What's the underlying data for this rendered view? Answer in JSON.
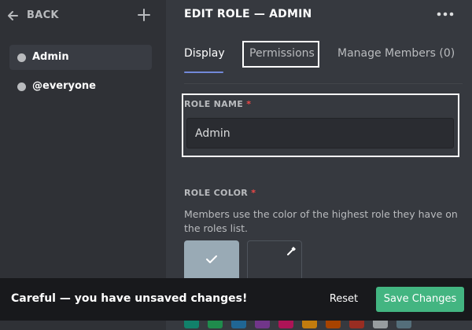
{
  "sidebar": {
    "back_label": "BACK",
    "roles": [
      {
        "label": "Admin",
        "active": true
      },
      {
        "label": "@everyone",
        "active": false
      }
    ]
  },
  "header": {
    "title": "EDIT ROLE — ADMIN"
  },
  "tabs": [
    {
      "label": "Display",
      "active": true
    },
    {
      "label": "Permissions",
      "active": false,
      "highlighted": true
    },
    {
      "label": "Manage Members (0)",
      "active": false
    }
  ],
  "role_name": {
    "label": "ROLE NAME",
    "required_mark": "*",
    "value": "Admin"
  },
  "role_color": {
    "label": "ROLE COLOR",
    "required_mark": "*",
    "description": "Members use the color of the highest role they have on the roles list.",
    "default_color": "#99aab5",
    "palette_row1": [
      "#1abc9c",
      "#2ecc71",
      "#3498db",
      "#9b59b6",
      "#e91e63",
      "#f1c40f",
      "#e67e22",
      "#e74c3c",
      "#95a5a6",
      "#607d8b"
    ],
    "palette_row2": [
      "#11806a",
      "#1f8b4c",
      "#206694",
      "#71368a",
      "#ad1457",
      "#c27c0e",
      "#a84300",
      "#992d22",
      "#979c9f",
      "#546e7a"
    ]
  },
  "unsaved": {
    "message": "Careful — you have unsaved changes!",
    "reset_label": "Reset",
    "save_label": "Save Changes"
  },
  "colors": {
    "background": "#36393f",
    "sidebar": "#2f3136",
    "accent": "#7289da",
    "save_green": "#43b581",
    "required_red": "#f04747"
  }
}
